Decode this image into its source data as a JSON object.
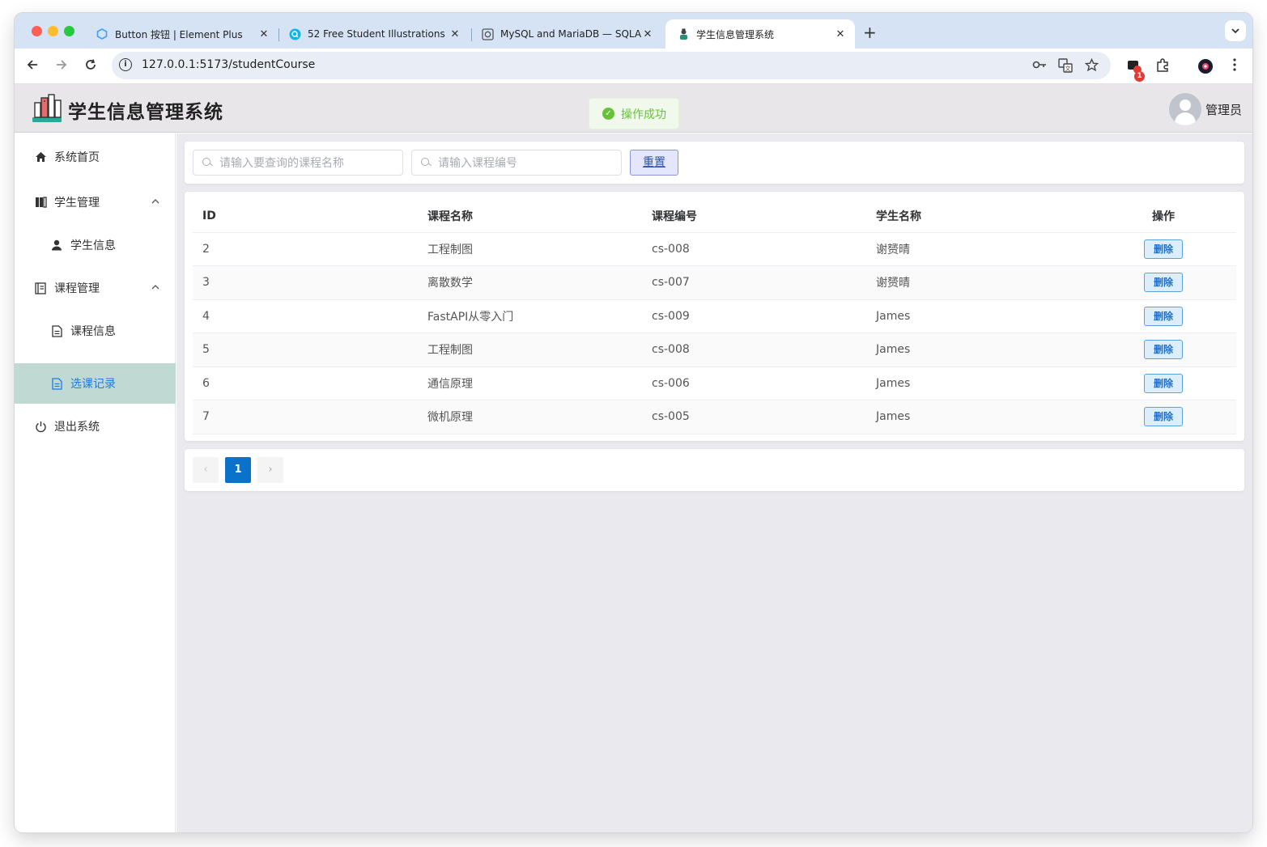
{
  "browser": {
    "tabs": [
      {
        "title": "Button 按钮 | Element Plus",
        "icon": "element-plus-icon",
        "close": "✕"
      },
      {
        "title": "52 Free Student Illustrations -",
        "icon": "search-site-icon",
        "close": "✕"
      },
      {
        "title": "MySQL and MariaDB — SQLA",
        "icon": "docs-icon",
        "close": "✕"
      },
      {
        "title": "学生信息管理系统",
        "icon": "student-favicon",
        "close": "✕"
      }
    ],
    "new_tab": "+",
    "url": "127.0.0.1:5173/studentCourse",
    "notification_count": "1",
    "colors": {
      "tabstrip": "#d5e3f5",
      "omnibox": "#e9eef6"
    }
  },
  "header": {
    "app_title": "学生信息管理系统",
    "toast": "操作成功",
    "admin_name": "管理员",
    "colors": {
      "background": "#e8e6e9",
      "toast_green": "#67c23a"
    }
  },
  "sidebar": {
    "items": [
      {
        "label": "系统首页",
        "icon": "home-icon"
      },
      {
        "label": "学生管理",
        "icon": "book-icon",
        "expanded": true
      },
      {
        "label": "学生信息",
        "icon": "user-icon"
      },
      {
        "label": "课程管理",
        "icon": "notebook-icon",
        "expanded": true
      },
      {
        "label": "课程信息",
        "icon": "document-icon"
      },
      {
        "label": "选课记录",
        "icon": "document-icon",
        "active": true
      },
      {
        "label": "退出系统",
        "icon": "power-icon"
      }
    ],
    "colors": {
      "active_bg": "#c0d9d3",
      "active_text": "#1e7be0"
    }
  },
  "search": {
    "course_name_placeholder": "请输入要查询的课程名称",
    "course_no_placeholder": "请输入课程编号",
    "reset_label": "重置"
  },
  "table": {
    "headers": [
      "ID",
      "课程名称",
      "课程编号",
      "学生名称",
      "操作"
    ],
    "rows": [
      {
        "id": "2",
        "course_name": "工程制图",
        "course_no": "cs-008",
        "student_name": "谢赟晴",
        "action": "删除"
      },
      {
        "id": "3",
        "course_name": "离散数学",
        "course_no": "cs-007",
        "student_name": "谢赟晴",
        "action": "删除"
      },
      {
        "id": "4",
        "course_name": "FastAPI从零入门",
        "course_no": "cs-009",
        "student_name": "James",
        "action": "删除"
      },
      {
        "id": "5",
        "course_name": "工程制图",
        "course_no": "cs-008",
        "student_name": "James",
        "action": "删除"
      },
      {
        "id": "6",
        "course_name": "通信原理",
        "course_no": "cs-006",
        "student_name": "James",
        "action": "删除"
      },
      {
        "id": "7",
        "course_name": "微机原理",
        "course_no": "cs-005",
        "student_name": "James",
        "action": "删除"
      }
    ]
  },
  "pagination": {
    "prev": "‹",
    "current_page": "1",
    "next": "›",
    "accent": "#0a72c9"
  }
}
